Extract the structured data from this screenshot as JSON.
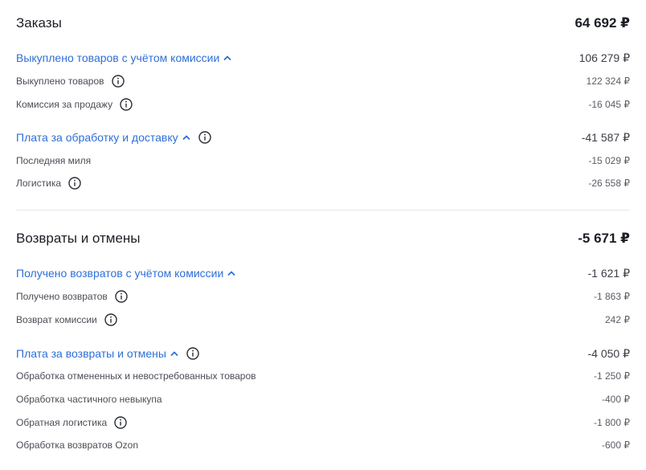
{
  "orders": {
    "title": "Заказы",
    "total": "64 692 ₽",
    "bought_group": {
      "label": "Выкуплено товаров с учётом комиссии",
      "value": "106 279 ₽",
      "items": [
        {
          "label": "Выкуплено товаров",
          "value": "122 324 ₽",
          "info": true
        },
        {
          "label": "Комиссия за продажу",
          "value": "-16 045 ₽",
          "info": true
        }
      ]
    },
    "delivery_group": {
      "label": "Плата за обработку и доставку",
      "value": "-41 587 ₽",
      "items": [
        {
          "label": "Последняя миля",
          "value": "-15 029 ₽",
          "info": false
        },
        {
          "label": "Логистика",
          "value": "-26 558 ₽",
          "info": true
        }
      ]
    }
  },
  "returns": {
    "title": "Возвраты и отмены",
    "total": "-5 671 ₽",
    "received_group": {
      "label": "Получено возвратов с учётом комиссии",
      "value": "-1 621 ₽",
      "items": [
        {
          "label": "Получено возвратов",
          "value": "-1 863 ₽",
          "info": true
        },
        {
          "label": "Возврат комиссии",
          "value": "242 ₽",
          "info": true
        }
      ]
    },
    "fees_group": {
      "label": "Плата за возвраты и отмены",
      "value": "-4 050 ₽",
      "items": [
        {
          "label": "Обработка отмененных и невостребованных товаров",
          "value": "-1 250 ₽",
          "info": false
        },
        {
          "label": "Обработка частичного невыкупа",
          "value": "-400 ₽",
          "info": false
        },
        {
          "label": "Обратная логистика",
          "value": "-1 800 ₽",
          "info": true
        },
        {
          "label": "Обработка возвратов Ozon",
          "value": "-600 ₽",
          "info": false
        }
      ]
    }
  },
  "icons": {
    "chevron": "chevron-up-icon",
    "info": "info-icon"
  },
  "colors": {
    "link": "#2e6fd8",
    "text": "#1c1f26",
    "muted": "#4a4d55",
    "divider": "#e6e8ec"
  }
}
